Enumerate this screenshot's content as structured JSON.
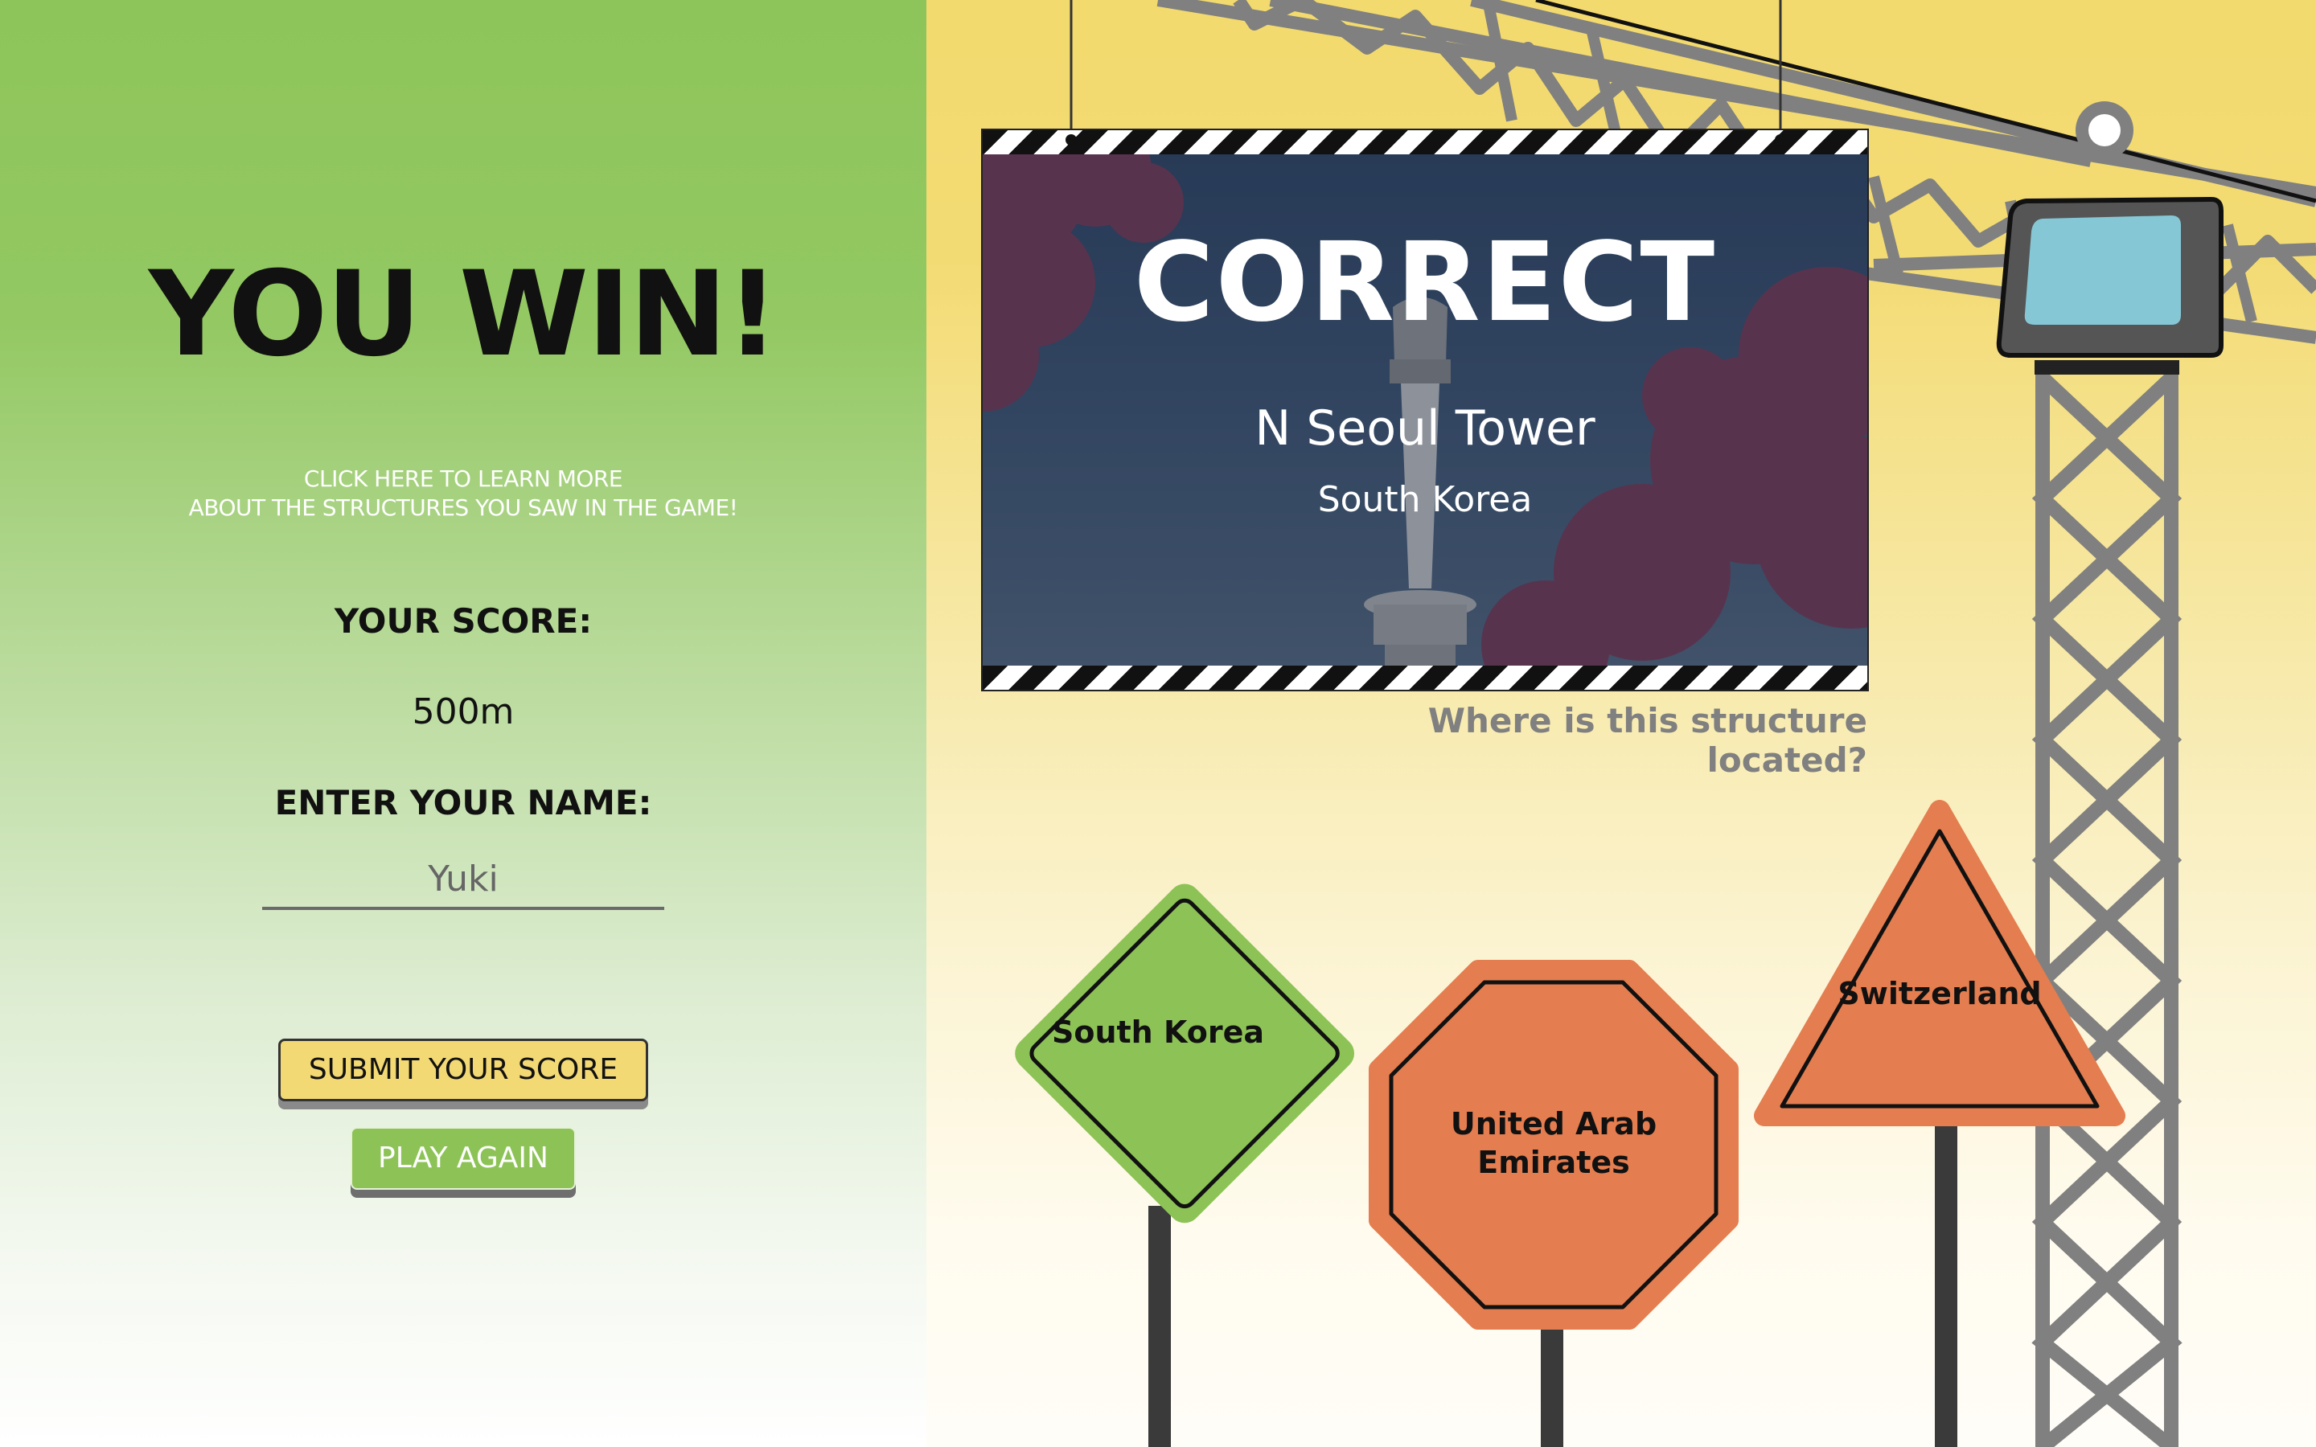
{
  "result_screen": {
    "title": "YOU WIN!",
    "learn_more_line1": "CLICK HERE TO LEARN MORE",
    "learn_more_line2": "ABOUT THE STRUCTURES YOU SAW IN THE GAME!",
    "score_label": "YOUR SCORE:",
    "score_value": "500m",
    "name_label": "ENTER YOUR NAME:",
    "name_value": "Yuki",
    "submit_label": "SUBMIT YOUR SCORE",
    "play_again_label": "PLAY AGAIN"
  },
  "billboard": {
    "result": "CORRECT",
    "structure_name": "N Seoul Tower",
    "structure_country": "South Korea"
  },
  "question": "Where is this structure located?",
  "answers": [
    {
      "label": "South Korea",
      "shape": "diamond",
      "color": "#8dc356"
    },
    {
      "label_line1": "United Arab",
      "label_line2": "Emirates",
      "shape": "octagon",
      "color": "#e47d4f"
    },
    {
      "label": "Switzerland",
      "shape": "triangle",
      "color": "#e47d4f"
    }
  ],
  "colors": {
    "left_bg": "#8ec55a",
    "right_bg": "#f3da6e",
    "submit_button": "#f3d974",
    "play_button": "#8dc356",
    "crane": "#808080",
    "crane_cab_window": "#86c7d6"
  }
}
